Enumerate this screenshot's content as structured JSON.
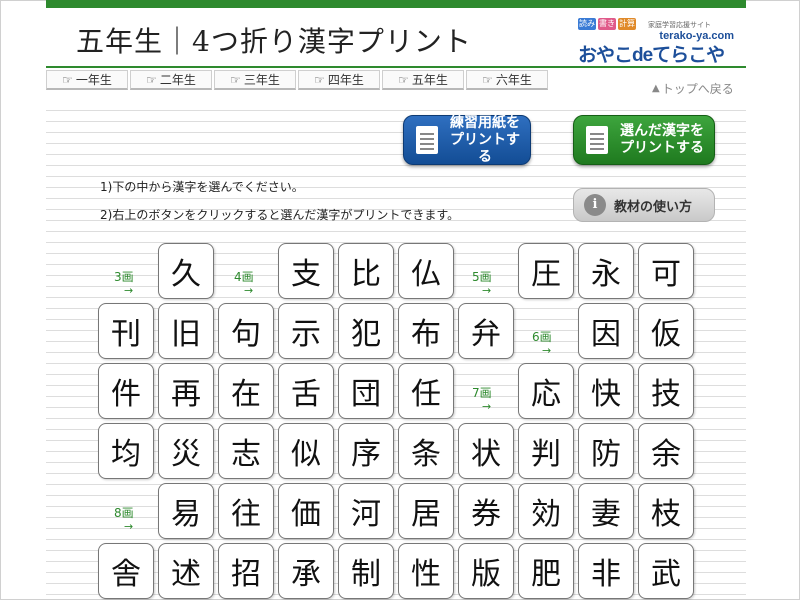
{
  "header": {
    "title": "五年生｜4つ折り漢字プリント",
    "logo": {
      "chips": [
        {
          "label": "読み",
          "color": "#3a7bd5"
        },
        {
          "label": "書き",
          "color": "#e05a8a"
        },
        {
          "label": "計算",
          "color": "#e08a2a"
        }
      ],
      "tagline": "家庭学習応援サイト",
      "domain": "terako-ya.com",
      "name": "おやこdeてらこや"
    }
  },
  "nav": {
    "items": [
      {
        "label": "一年生"
      },
      {
        "label": "二年生"
      },
      {
        "label": "三年生"
      },
      {
        "label": "四年生"
      },
      {
        "label": "五年生"
      },
      {
        "label": "六年生"
      }
    ],
    "back_label": "トップへ戻る"
  },
  "buttons": {
    "print_blank": {
      "line1": "練習用紙を",
      "line2": "プリントする"
    },
    "print_selected": {
      "line1": "選んだ漢字を",
      "line2": "プリントする"
    },
    "howto": "教材の使い方"
  },
  "instructions": {
    "step1": "1)下の中から漢字を選んでください。",
    "step2": "2)右上のボタンをクリックすると選んだ漢字がプリントできます。"
  },
  "stroke_labels": [
    {
      "label": "3画"
    },
    {
      "label": "4画"
    },
    {
      "label": "5画"
    },
    {
      "label": "6画"
    },
    {
      "label": "7画"
    },
    {
      "label": "8画"
    }
  ],
  "kanji_rows": [
    [
      "",
      "久",
      "",
      "支",
      "比",
      "仏",
      "",
      "圧",
      "永",
      "可"
    ],
    [
      "刊",
      "旧",
      "句",
      "示",
      "犯",
      "布",
      "弁",
      "",
      "因",
      "仮"
    ],
    [
      "件",
      "再",
      "在",
      "舌",
      "団",
      "任",
      "",
      "応",
      "快",
      "技"
    ],
    [
      "均",
      "災",
      "志",
      "似",
      "序",
      "条",
      "状",
      "判",
      "防",
      "余"
    ],
    [
      "",
      "易",
      "往",
      "価",
      "河",
      "居",
      "券",
      "効",
      "妻",
      "枝"
    ],
    [
      "舎",
      "述",
      "招",
      "承",
      "制",
      "性",
      "版",
      "肥",
      "非",
      "武"
    ]
  ],
  "colors": {
    "accent_green": "#2e8a2e",
    "button_blue": "#1a5aa8",
    "button_green": "#2a8c2a",
    "logo_blue": "#1d4f9a"
  }
}
